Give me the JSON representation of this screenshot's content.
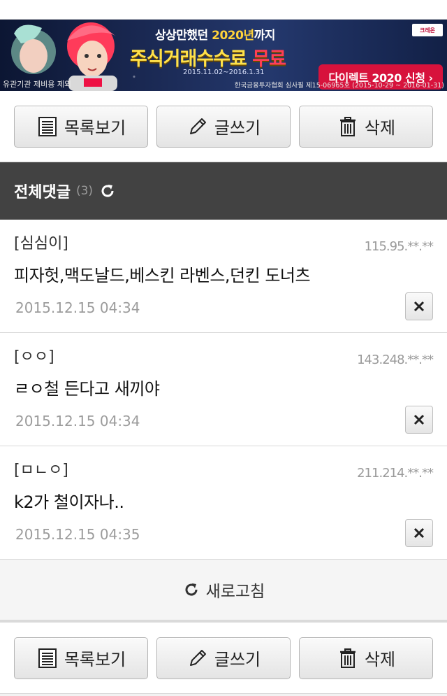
{
  "banner": {
    "line1_pre": "상상만했던 ",
    "line1_year": "2020년",
    "line1_post": "까지",
    "line2_main": "주식거래수수료 ",
    "line2_free": "무료",
    "period": "2015.11.02~2016.1.31",
    "cta": "다이렉트 2020 신청 ›",
    "brand": "크레온",
    "note_left": "유관기관 제비용 제외",
    "note_right": "한국금융투자협회 심사필 제15-06965호 (2015-10-29 ~ 2016-01-31)"
  },
  "toolbar": {
    "list_label": "목록보기",
    "write_label": "글쓰기",
    "delete_label": "삭제"
  },
  "comments_header": {
    "title": "전체댓글",
    "count": "(3)"
  },
  "comments": [
    {
      "author": "[심심이]",
      "ip": "115.95.**.**",
      "body": "피자헛,맥도날드,베스킨 라벤스,던킨 도너츠",
      "date": "2015.12.15 04:34"
    },
    {
      "author": "[ㅇㅇ]",
      "ip": "143.248.**.**",
      "body": "ㄹㅇ철 든다고 새끼야",
      "date": "2015.12.15 04:34"
    },
    {
      "author": "[ㅁㄴㅇ]",
      "ip": "211.214.**.**",
      "body": "k2가 철이자나..",
      "date": "2015.12.15 04:35"
    }
  ],
  "refresh_label": "새로고침",
  "icons": {
    "list": "list-icon",
    "write": "pencil-icon",
    "delete": "trash-icon",
    "refresh": "refresh-icon",
    "close": "close-icon"
  },
  "colors": {
    "header_bg": "#424242",
    "cta_bg": "#d7123c",
    "banner_yellow": "#ffe14a"
  }
}
